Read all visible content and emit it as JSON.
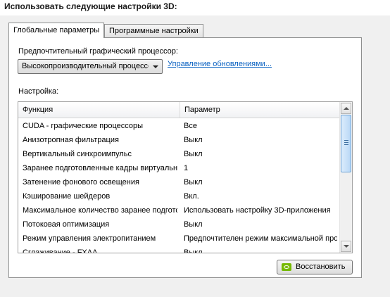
{
  "header": {
    "title": "Использовать следующие настройки 3D:"
  },
  "tabs": [
    {
      "label": "Глобальные параметры",
      "active": true
    },
    {
      "label": "Программные настройки",
      "active": false
    }
  ],
  "gpu": {
    "label": "Предпочтительный графический процессор:",
    "selected": "Высокопроизводительный процессор NVIDIA",
    "manage_link": "Управление обновлениями..."
  },
  "settings": {
    "label": "Настройка:",
    "columns": [
      "Функция",
      "Параметр"
    ],
    "rows": [
      {
        "feature": "CUDA - графические процессоры",
        "value": "Все"
      },
      {
        "feature": "Анизотропная фильтрация",
        "value": "Выкл"
      },
      {
        "feature": "Вертикальный синхроимпульс",
        "value": "Выкл"
      },
      {
        "feature": "Заранее подготовленные кадры виртуальной реальности",
        "value": "1"
      },
      {
        "feature": "Затенение фонового освещения",
        "value": "Выкл"
      },
      {
        "feature": "Кэширование шейдеров",
        "value": "Вкл."
      },
      {
        "feature": "Максимальное количество заранее подготовленных кадров",
        "value": "Использовать настройку 3D-приложения"
      },
      {
        "feature": "Потоковая оптимизация",
        "value": "Выкл"
      },
      {
        "feature": "Режим управления электропитанием",
        "value": "Предпочтителен режим максимальной производительности"
      },
      {
        "feature": "Сглаживание - FXAA",
        "value": "Выкл"
      }
    ]
  },
  "restore_button": {
    "label": "Восстановить"
  },
  "colors": {
    "link": "#0a62c2",
    "nvidia_green": "#76b900",
    "scroll_thumb": "#b9d8f6"
  }
}
